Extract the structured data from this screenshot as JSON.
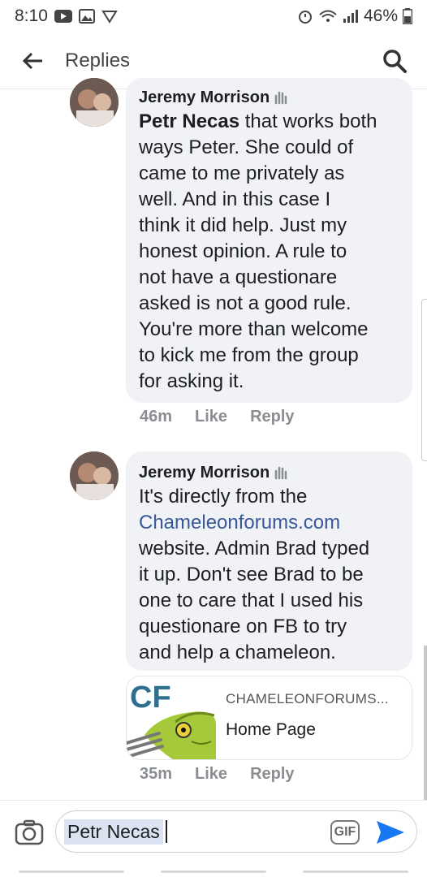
{
  "status_bar": {
    "time": "8:10",
    "battery": "46%"
  },
  "app_bar": {
    "title": "Replies"
  },
  "comments": [
    {
      "author": "Jeremy Morrison",
      "mention": "Petr Necas",
      "lines": [
        " that works both",
        "ways Peter. She could of",
        "came to me privately as",
        "well. And in this case I",
        "think it did help. Just my",
        "honest opinion. A rule to",
        "not have a questionare",
        "asked is not a good rule.",
        "You're more than welcome",
        "to kick me from the group",
        "for asking it."
      ],
      "time": "46m",
      "like": "Like",
      "reply": "Reply"
    },
    {
      "author": "Jeremy Morrison",
      "lines": [
        "It's directly from the",
        "Chameleonforums.com",
        "website. Admin Brad typed",
        "it up. Don't see Brad to be",
        "one to care that I used his",
        "questionare on FB to try",
        "and help a chameleon."
      ],
      "time": "35m",
      "like": "Like",
      "reply": "Reply",
      "link_card": {
        "domain": "CHAMELEONFORUMS...",
        "title": "Home Page",
        "logo_text": "CF"
      }
    }
  ],
  "composer": {
    "value": "Petr Necas",
    "gif_label": "GIF"
  },
  "colors": {
    "link": "#385898",
    "send": "#1877f2",
    "bubble": "#f0f2f5"
  }
}
